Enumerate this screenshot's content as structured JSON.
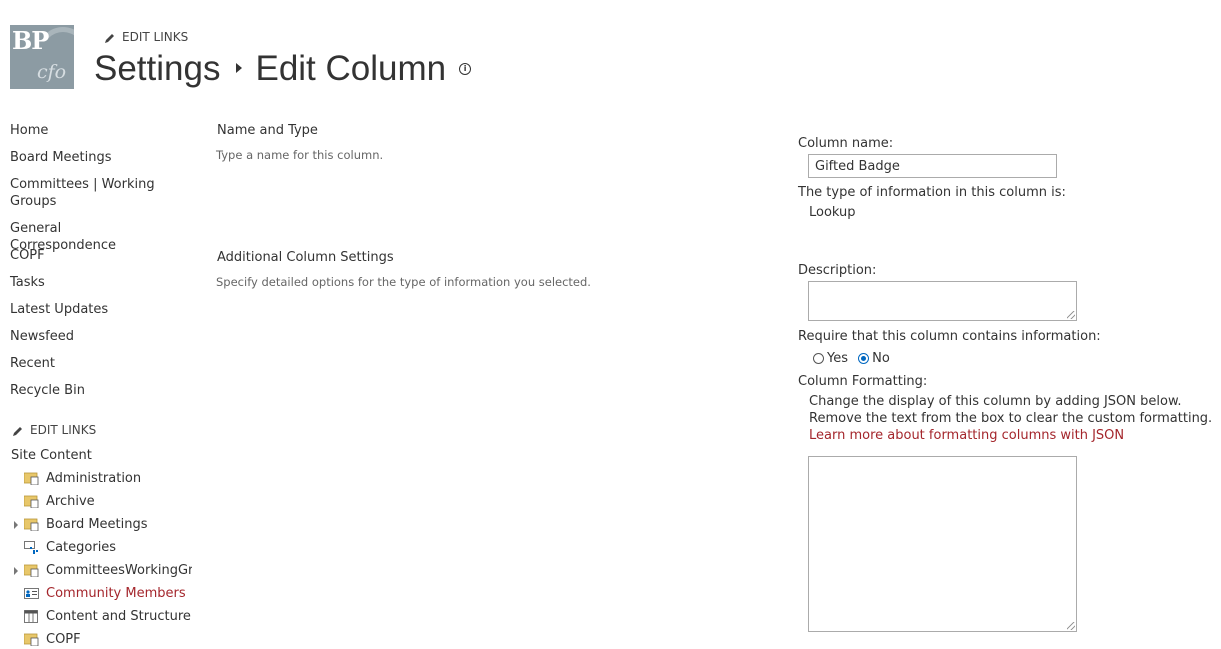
{
  "header": {
    "logo_text": "BP",
    "logo_subtext": "cfo",
    "edit_links": "EDIT LINKS",
    "breadcrumb_parent": "Settings",
    "breadcrumb_current": "Edit Column",
    "info_glyph": "i"
  },
  "nav": {
    "items": [
      "Home",
      "Board Meetings",
      "Committees | Working Groups",
      "General Correspondence",
      "COPF",
      "Tasks",
      "Latest Updates",
      "Newsfeed",
      "Recent",
      "Recycle Bin"
    ],
    "edit_links": "EDIT LINKS",
    "site_content": "Site Content",
    "tree": [
      {
        "label": "Administration",
        "expandable": false,
        "icon": "library-icon"
      },
      {
        "label": "Archive",
        "expandable": false,
        "icon": "library-icon"
      },
      {
        "label": "Board Meetings",
        "expandable": true,
        "icon": "library-icon"
      },
      {
        "label": "Categories",
        "expandable": false,
        "icon": "list-icon"
      },
      {
        "label": "CommitteesWorkingGroups",
        "expandable": true,
        "icon": "library-icon"
      },
      {
        "label": "Community Members",
        "expandable": false,
        "icon": "contacts-icon",
        "highlight": true
      },
      {
        "label": "Content and Structure Reports",
        "expandable": false,
        "icon": "table-icon"
      },
      {
        "label": "COPF",
        "expandable": false,
        "icon": "library-icon"
      }
    ]
  },
  "sections": {
    "name_type": {
      "title": "Name and Type",
      "description": "Type a name for this column."
    },
    "additional": {
      "title": "Additional Column Settings",
      "description": "Specify detailed options for the type of information you selected."
    }
  },
  "form": {
    "column_name_label": "Column name:",
    "column_name_value": "Gifted Badge",
    "type_label": "The type of information in this column is:",
    "type_value": "Lookup",
    "description_label": "Description:",
    "description_value": "",
    "require_label": "Require that this column contains information:",
    "require_yes": "Yes",
    "require_no": "No",
    "require_selected": "No",
    "formatting_label": "Column Formatting:",
    "formatting_line1": "Change the display of this column by adding JSON below.",
    "formatting_line2": "Remove the text from the box to clear the custom formatting.",
    "formatting_link": "Learn more about formatting columns with JSON",
    "formatting_value": ""
  },
  "colors": {
    "link_red": "#a4262c",
    "text": "#333333",
    "radio_accent": "#0067c0"
  }
}
